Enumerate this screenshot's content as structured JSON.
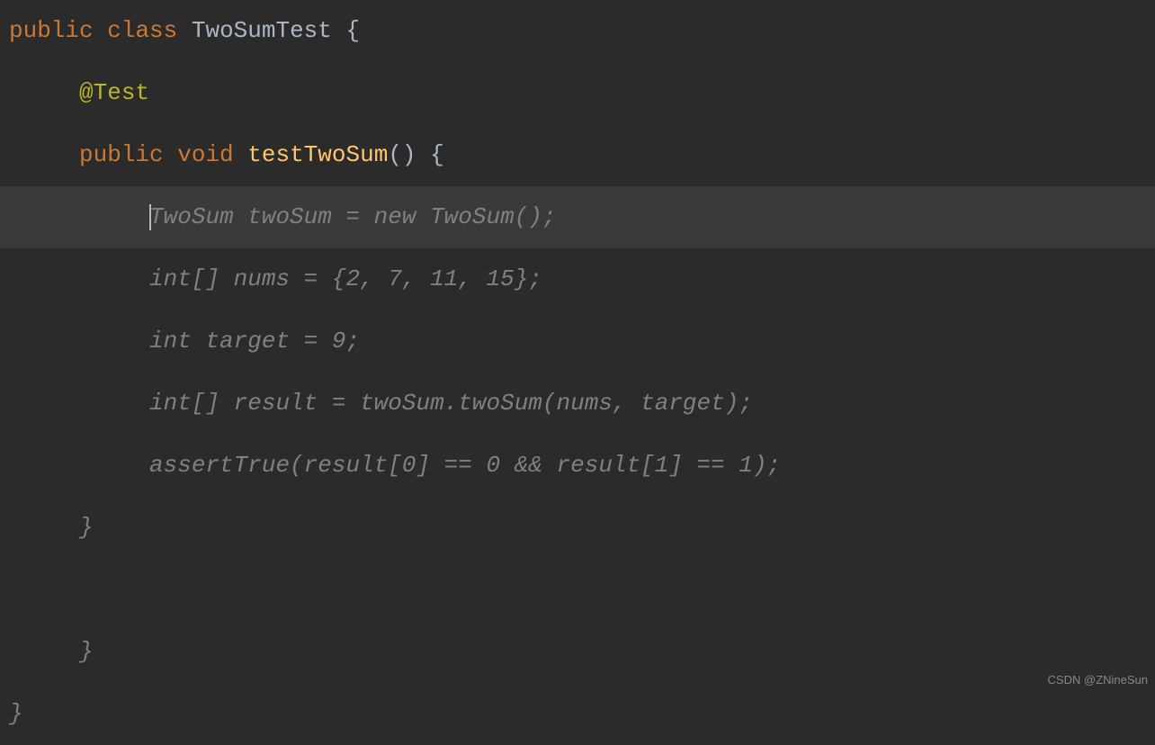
{
  "code": {
    "line1": {
      "kw1": "public",
      "kw2": "class",
      "className": "TwoSumTest",
      "brace": "{"
    },
    "line2": {
      "annotation": "@Test"
    },
    "line3": {
      "kw1": "public",
      "kw2": "void",
      "method": "testTwoSum",
      "parens": "()",
      "brace": "{"
    },
    "suggestion1": "TwoSum twoSum = new TwoSum();",
    "suggestion2": "int[] nums = {2, 7, 11, 15};",
    "suggestion3": "int target = 9;",
    "suggestion4": "int[] result = twoSum.twoSum(nums, target);",
    "suggestion5": "assertTrue(result[0] == 0 && result[1] == 1);",
    "closeBrace1": "}",
    "closeBrace2": "}",
    "closeBrace3": "}"
  },
  "watermark": "CSDN @ZNineSun"
}
